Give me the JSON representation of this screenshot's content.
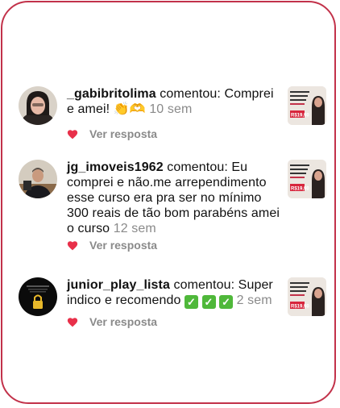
{
  "comments": [
    {
      "username": "_gabibritolima",
      "verb": " comentou:",
      "body": " Comprei e amei! 👏🫶",
      "time": "10 sem",
      "reply_label": "Ver resposta",
      "avatar_icon": "person-photo"
    },
    {
      "username": "jg_imoveis1962",
      "verb": " comentou:",
      "body": " Eu comprei e não.me arrependimento esse curso era pra ser no mínimo 300 reais de tão bom parabéns amei o curso",
      "time": "12 sem",
      "reply_label": "Ver resposta",
      "avatar_icon": "person-photo"
    },
    {
      "username": "junior_play_lista",
      "verb": " comentou:",
      "body": " Super indico e recomendo",
      "checks": [
        "✓",
        "✓",
        "✓"
      ],
      "time": "2 sem",
      "reply_label": "Ver resposta",
      "avatar_icon": "lock-logo"
    }
  ],
  "post_thumbnail": {
    "headline": "TRÁFEGO PAGO NÃO É IMPORTANTE",
    "price": "R$19,90"
  },
  "colors": {
    "border": "#c2324a",
    "heart": "#e8304a",
    "muted": "#8a8a8a",
    "check": "#4fb83a"
  }
}
